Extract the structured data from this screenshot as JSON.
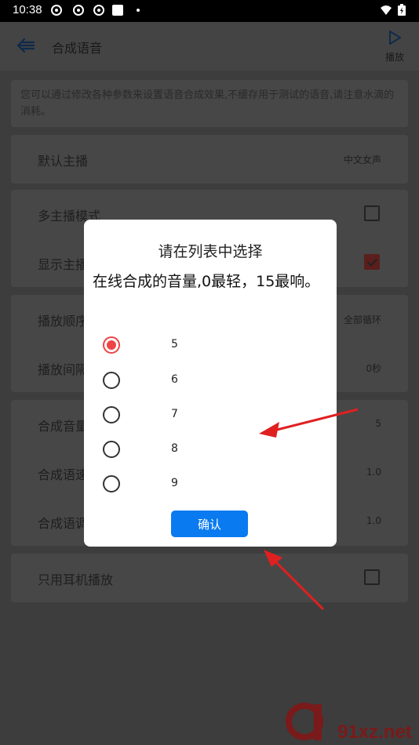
{
  "status_bar": {
    "time": "10:38"
  },
  "app_bar": {
    "title": "合成语音",
    "play_label": "播放"
  },
  "description": "您可以通过修改各种参数来设置语音合成效果,不缓存用于测试的语音,请注意水滴的消耗。",
  "settings": {
    "default_anchor": {
      "label": "默认主播",
      "value": "中文女声"
    },
    "multi_anchor": {
      "label": "多主播模式",
      "checked": false
    },
    "show_anchor": {
      "label": "显示主播",
      "checked": true
    },
    "play_order": {
      "label": "播放顺序",
      "value": "全部循环"
    },
    "play_interval": {
      "label": "播放间隔",
      "value": "0秒"
    },
    "volume": {
      "label": "合成音量",
      "value": "5"
    },
    "speed": {
      "label": "合成语速",
      "value": "1.0"
    },
    "pitch": {
      "label": "合成语调",
      "value": "1.0"
    },
    "earphone_only": {
      "label": "只用耳机播放",
      "checked": false
    }
  },
  "dialog": {
    "title": "请在列表中选择",
    "message": "在线合成的音量,0最轻，15最响。",
    "options": [
      "5",
      "6",
      "7",
      "8",
      "9"
    ],
    "selected": "5",
    "confirm_label": "确认"
  },
  "watermark": {
    "text": "91xz.net"
  },
  "colors": {
    "accent": "#0a7af0",
    "radio_selected": "#e44444",
    "arrow": "#e02020"
  }
}
